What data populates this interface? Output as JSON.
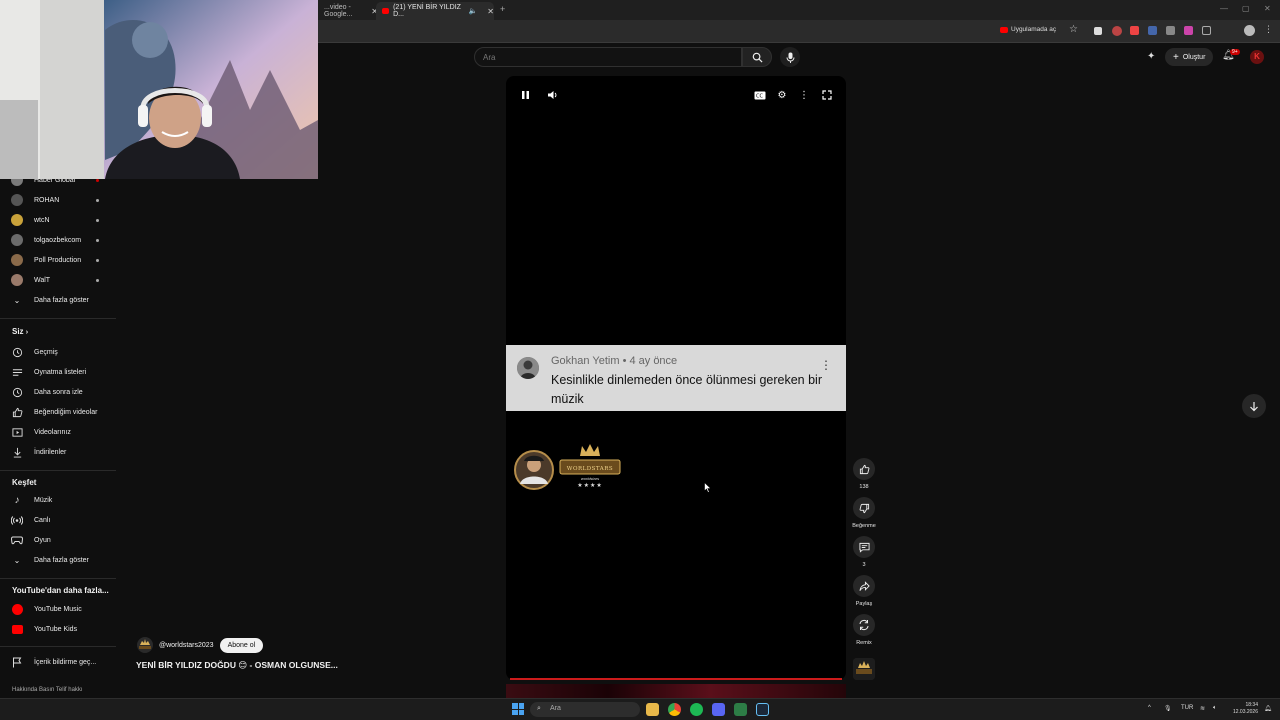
{
  "browser": {
    "tabs": [
      {
        "label": "...video - Google...",
        "active": false
      },
      {
        "label": "(21) YENİ BİR YILDIZ D...",
        "active": true
      }
    ],
    "new_tab": "+",
    "app_open_label": "Uygulamada aç"
  },
  "youtube": {
    "search_placeholder": "Ara",
    "create_label": "Oluştur",
    "notification_count": "9+"
  },
  "sidebar": {
    "subscriptions": [
      {
        "label": "Haber Global",
        "avatar_color": "#7a7a7a"
      },
      {
        "label": "ROHAN",
        "avatar_color": "#555555"
      },
      {
        "label": "wtcN",
        "avatar_color": "#c9a23a"
      },
      {
        "label": "tolgaozbekcom",
        "avatar_color": "#6b6b6b"
      },
      {
        "label": "Poll Production",
        "avatar_color": "#8a6a4a"
      },
      {
        "label": "WalT",
        "avatar_color": "#9a7a6a"
      }
    ],
    "show_more_1": "Daha fazla göster",
    "you_section": "Siz",
    "you_items": [
      {
        "label": "Geçmiş",
        "icon": "history-icon"
      },
      {
        "label": "Oynatma listeleri",
        "icon": "playlist-icon"
      },
      {
        "label": "Daha sonra izle",
        "icon": "clock-icon"
      },
      {
        "label": "Beğendiğim videolar",
        "icon": "thumb-up-icon"
      },
      {
        "label": "Videolarınız",
        "icon": "video-icon"
      },
      {
        "label": "İndirilenler",
        "icon": "download-icon"
      }
    ],
    "explore_section": "Keşfet",
    "explore_items": [
      {
        "label": "Müzik",
        "icon": "music-icon"
      },
      {
        "label": "Canlı",
        "icon": "live-icon"
      },
      {
        "label": "Oyun",
        "icon": "gaming-icon"
      }
    ],
    "show_more_2": "Daha fazla göster",
    "more_section": "YouTube'dan daha fazla...",
    "more_items": [
      {
        "label": "YouTube Music",
        "color": "#ff0000"
      },
      {
        "label": "YouTube Kids",
        "color": "#ff0000"
      }
    ],
    "report_history": "İçerik bildirme geç...",
    "footer": "Hakkında  Basın  Telif hakkı"
  },
  "comment": {
    "author": "Gokhan Yetim",
    "age": "• 4 ay önce",
    "text": "Kesinlikle dinlemeden önce ölünmesi gereken bir müzik"
  },
  "logo": {
    "brand": "WORLDSTARS",
    "tagline": "worldstars"
  },
  "actions": {
    "like_count": "138",
    "dislike_label": "Beğenme",
    "comment_count": "3",
    "share_label": "Paylaş",
    "remix_label": "Remix"
  },
  "short": {
    "channel": "@worldstars2023",
    "subscribe": "Abone ol",
    "title": "YENİ BİR YILDIZ DOĞDU 😊 - OSMAN OLGUNSE..."
  },
  "taskbar": {
    "search_placeholder": "Ara",
    "lang": "TUR",
    "time": "18:34",
    "date": "12.03.2026"
  },
  "colors": {
    "accent_red": "#cc0000",
    "comment_bg": "#d9d9d9",
    "page_bg": "#0f0f0f"
  }
}
